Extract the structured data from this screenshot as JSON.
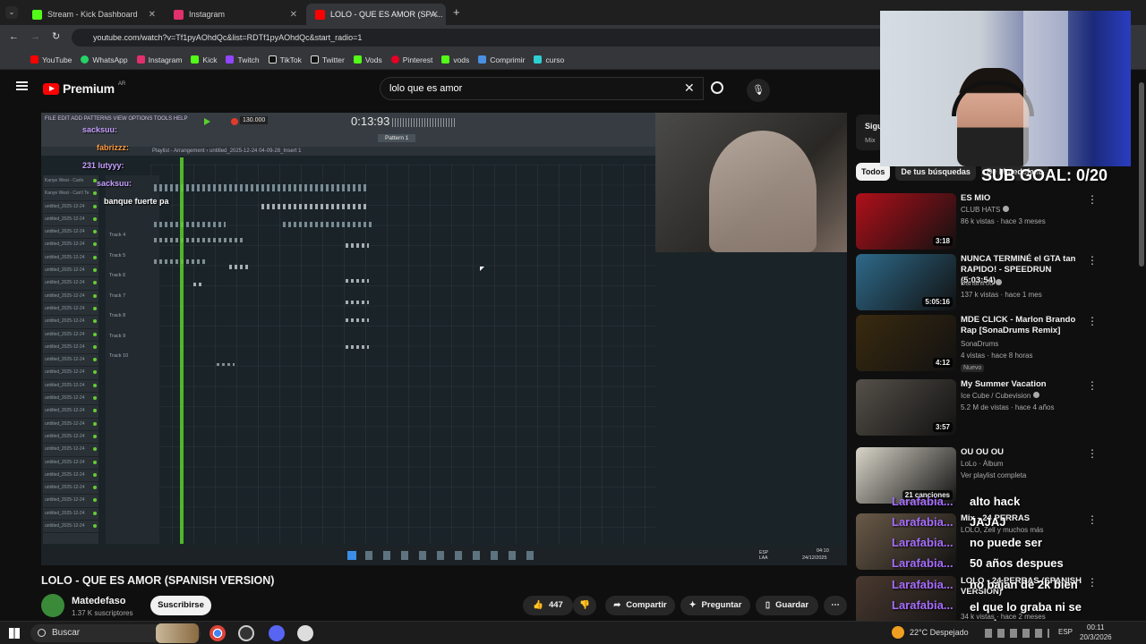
{
  "browser": {
    "tabs": [
      {
        "label": "Stream - Kick Dashboard",
        "color": "#53fc18"
      },
      {
        "label": "Instagram",
        "color": "#e1306c"
      },
      {
        "label": "LOLO - QUE ES AMOR (SPA...",
        "color": "#ff0000"
      }
    ],
    "url": "youtube.com/watch?v=Tf1pyAOhdQc&list=RDTf1pyAOhdQc&start_radio=1",
    "bookmarks": [
      {
        "label": "YouTube",
        "color": "#ff0000"
      },
      {
        "label": "WhatsApp",
        "color": "#25d366"
      },
      {
        "label": "Instagram",
        "color": "#e1306c"
      },
      {
        "label": "Kick",
        "color": "#53fc18"
      },
      {
        "label": "Twitch",
        "color": "#9146ff"
      },
      {
        "label": "TikTok",
        "color": "#ffffff"
      },
      {
        "label": "Twitter",
        "color": "#ffffff"
      },
      {
        "label": "Vods",
        "color": "#53fc18"
      },
      {
        "label": "Pinterest",
        "color": "#e60023"
      },
      {
        "label": "vods",
        "color": "#53fc18"
      },
      {
        "label": "Comprimir",
        "color": "#4a90e2"
      },
      {
        "label": "curso",
        "color": "#2ecfd2"
      }
    ]
  },
  "youtube": {
    "logo": "Premium",
    "region": "AR",
    "search_value": "lolo que es amor"
  },
  "video": {
    "title": "LOLO - QUE ES AMOR (SPANISH VERSION)",
    "channel": "Matedefaso",
    "subscribers": "1.37 K suscriptores",
    "subscribe_label": "Suscribirse",
    "likes": "447",
    "share_label": "Compartir",
    "ask_label": "Preguntar",
    "save_label": "Guardar",
    "fl_time": "0:13:93",
    "fl_tempo": "130.000",
    "fl_pattern": "Pattern 1",
    "fl_playlist": "Playlist - Arrangement › untitled_2025-12-24 04-09-28_Insert 1",
    "inner_chat": [
      {
        "name": "sacksuu:",
        "color": "#c8a0ff"
      },
      {
        "name": "fabrizzz:",
        "color": "#ff9a3c"
      },
      {
        "name": "231 lutyyy:",
        "color": "#c8a0ff"
      },
      {
        "name": "sacksuu:",
        "color": "#c8a0ff"
      },
      {
        "name": "banque fuerte pa",
        "color": "#ffffff"
      }
    ],
    "track_names": [
      "Kanye West - Carlo",
      "Kanye West - Can't Te",
      "untitled_2025-12-24",
      "untitled_2025-12-24",
      "untitled_2025-12-24",
      "untitled_2025-12-24",
      "untitled_2025-12-24",
      "untitled_2025-12-24",
      "untitled_2025-12-24",
      "untitled_2025-12-24",
      "untitled_2025-12-24",
      "untitled_2025-12-24",
      "untitled_2025-12-24",
      "untitled_2025-12-24",
      "untitled_2025-12-24",
      "untitled_2025-12-24",
      "untitled_2025-12-24",
      "untitled_2025-12-24",
      "untitled_2025-12-24",
      "untitled_2025-12-24",
      "untitled_2025-12-24",
      "untitled_2025-12-24",
      "untitled_2025-12-24",
      "untitled_2025-12-24",
      "untitled_2025-12-24",
      "untitled_2025-12-24",
      "untitled_2025-12-24",
      "untitled_2025-12-24"
    ],
    "track_labels": [
      "Track 4",
      "Track 5",
      "Track 6",
      "Track 7",
      "Track 8",
      "Track 9",
      "Track 10"
    ],
    "inner_taskbar_time": "04:10",
    "inner_taskbar_date": "24/12/2025",
    "inner_lang": "ESP LAA"
  },
  "sidebar": {
    "top_label": "Sigu",
    "top_sub": "Mix",
    "chips": [
      {
        "label": "Todos"
      },
      {
        "label": "De tus búsquedas"
      },
      {
        "label": "De Matedefaso"
      }
    ],
    "items": [
      {
        "title": "ES MIO",
        "channel": "CLUB HATS",
        "meta": "86 k vistas · hace 3 meses",
        "duration": "3:18",
        "thumb": "#b0101a",
        "verified": true
      },
      {
        "title": "NUNCA TERMINÉ el GTA tan RAPIDO! - SPEEDRUN (5:03:54)",
        "channel": "Bananirou",
        "meta": "137 k vistas · hace 1 mes",
        "duration": "5:05:16",
        "thumb": "#2e6a8a",
        "verified": true
      },
      {
        "title": "MDE CLICK - Marlon Brando Rap [SonaDrums Remix]",
        "channel": "SonaDrums",
        "meta": "4 vistas · hace 8 horas",
        "duration": "4:12",
        "badge": "Nuevo",
        "thumb": "#3a2a10"
      },
      {
        "title": "My Summer Vacation",
        "channel": "Ice Cube / Cubevision",
        "meta": "5.2 M de vistas · hace 4 años",
        "duration": "3:57",
        "thumb": "#555049",
        "verified": true
      },
      {
        "title": "OU OU OU",
        "channel": "LoLo · Álbum",
        "meta": "Ver playlist completa",
        "duration": "21 canciones",
        "thumb": "#d8d4c8"
      },
      {
        "title": "Mix - 24 PERRAS",
        "channel": "LOLO, Zell y muchos más",
        "meta": "",
        "thumb": "#6a5a48"
      },
      {
        "title": "LOLO - 24 PERRAS (SPANISH VERSION)",
        "channel": "",
        "meta": "34 k vistas · hace 2 meses",
        "thumb": "#4a3a30"
      }
    ]
  },
  "overlay": {
    "sub_goal": "SUB GOAL: 0/20",
    "chat": [
      {
        "name": "Larafabia...",
        "msg": "alto hack"
      },
      {
        "name": "Larafabia...",
        "msg": "JAJAJ"
      },
      {
        "name": "Larafabia...",
        "msg": "no puede ser"
      },
      {
        "name": "Larafabia...",
        "msg": "50 años despues"
      },
      {
        "name": "Larafabia...",
        "msg": "no bajan de 2k bien"
      },
      {
        "name": "Larafabia...",
        "msg": "el que lo graba ni se movio"
      }
    ]
  },
  "taskbar": {
    "search_placeholder": "Buscar",
    "weather": "22°C  Despejado",
    "lang": "ESP",
    "time": "00:11",
    "date": "20/3/2026"
  }
}
